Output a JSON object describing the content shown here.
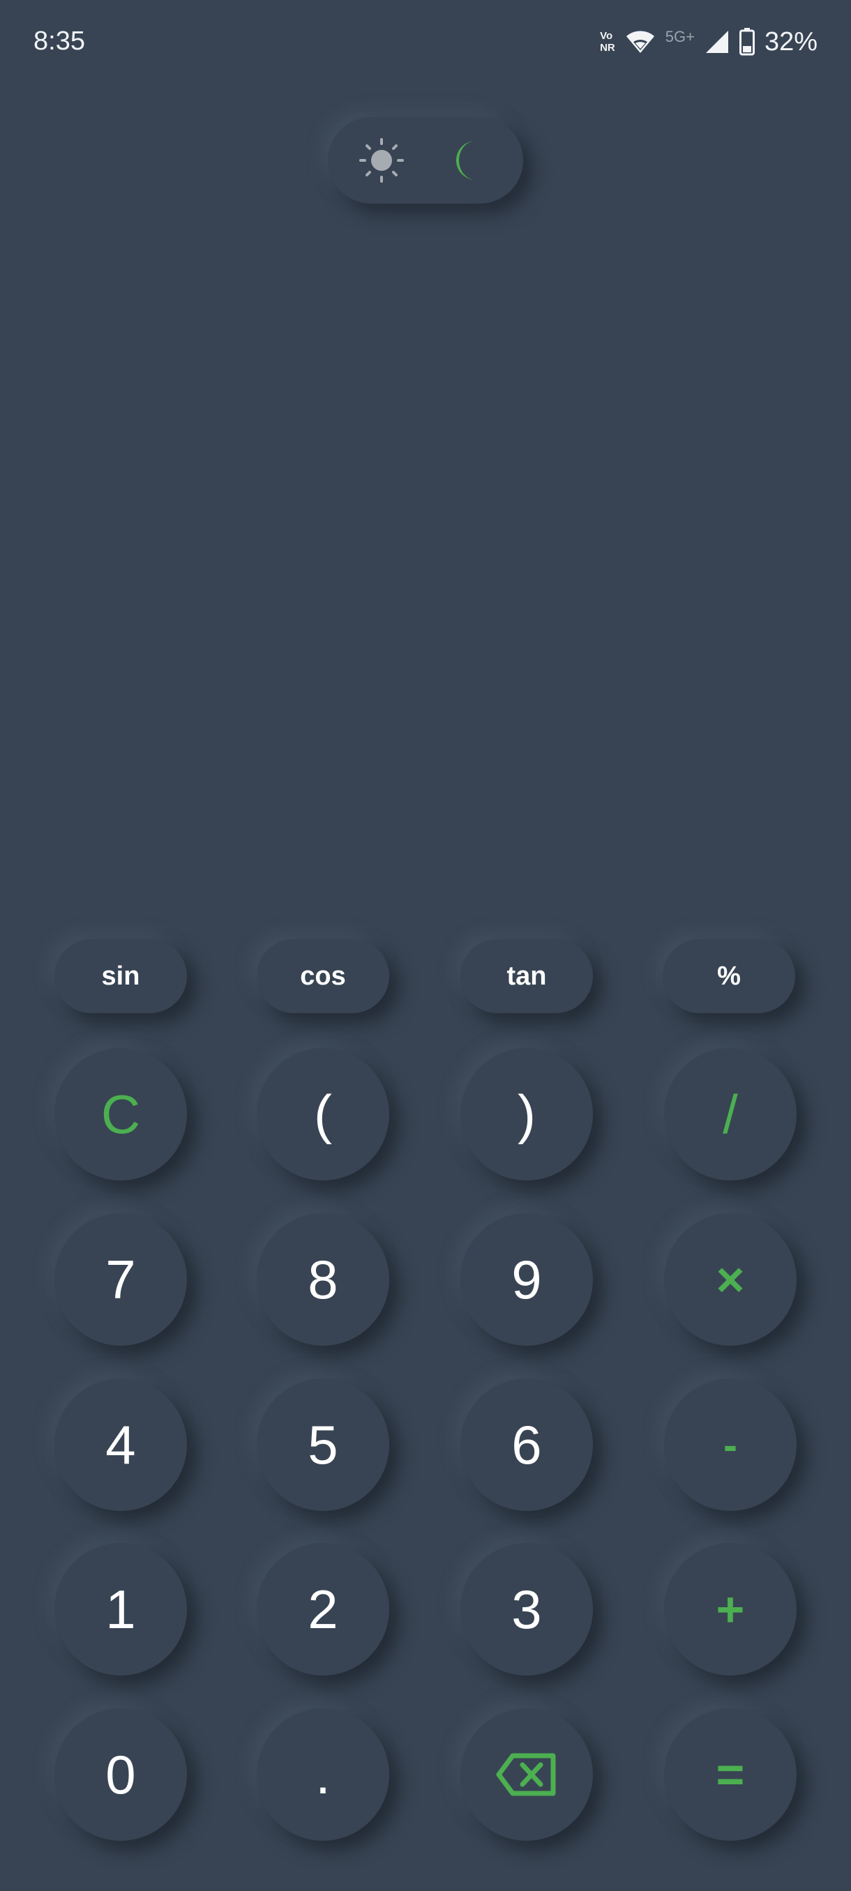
{
  "status_bar": {
    "time": "8:35",
    "volte_top": "Vo",
    "volte_bottom": "NR",
    "network_type": "5G+",
    "battery": "32%",
    "icons": [
      "volte-icon",
      "wifi-icon",
      "signal-icon",
      "battery-icon"
    ]
  },
  "theme_toggle": {
    "light_icon": "sun-icon",
    "dark_icon": "moon-icon",
    "active": "dark"
  },
  "display": {
    "expression": "",
    "result": ""
  },
  "function_keys": [
    "sin",
    "cos",
    "tan",
    "%"
  ],
  "keys": {
    "clear": "C",
    "open_paren": "(",
    "close_paren": ")",
    "divide": "/",
    "seven": "7",
    "eight": "8",
    "nine": "9",
    "multiply": "×",
    "four": "4",
    "five": "5",
    "six": "6",
    "subtract": "-",
    "one": "1",
    "two": "2",
    "three": "3",
    "add": "+",
    "zero": "0",
    "decimal": ".",
    "backspace_icon": "backspace-icon",
    "equals": "="
  },
  "colors": {
    "background": "#384453",
    "accent": "#4caf50",
    "text": "#ffffff",
    "muted": "#9aa3ad"
  }
}
